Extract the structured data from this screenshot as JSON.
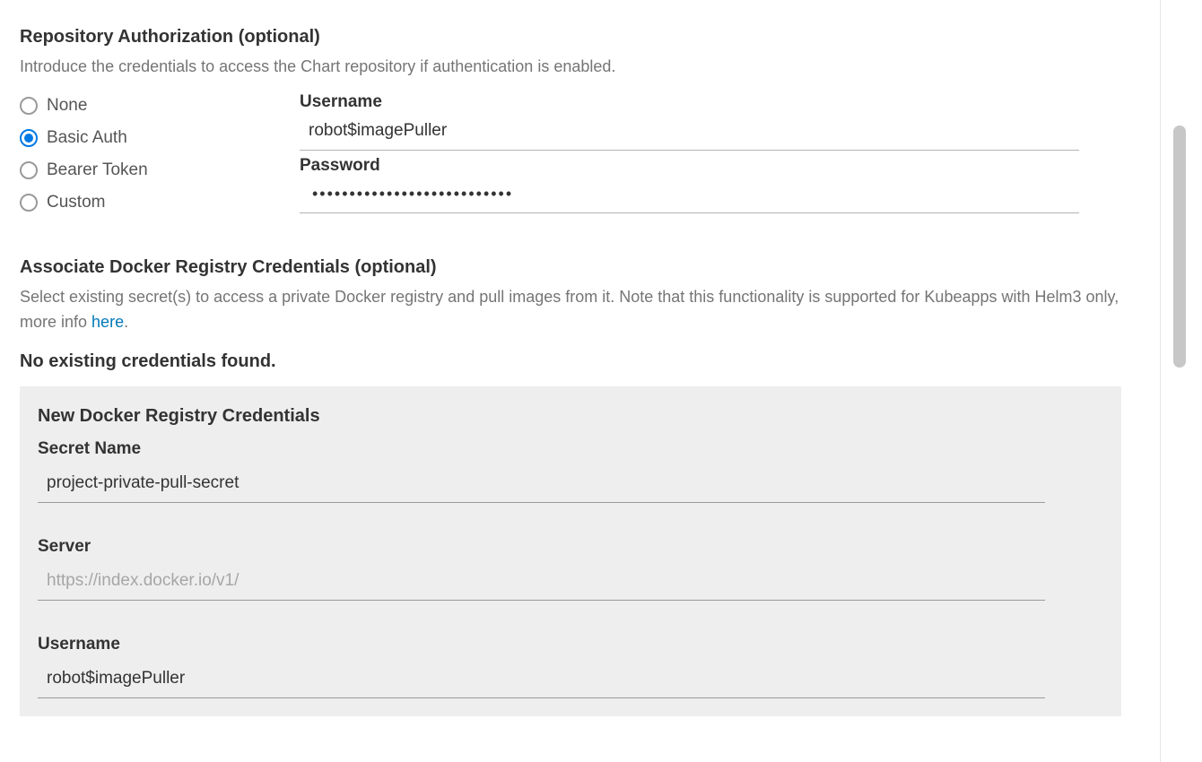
{
  "repoAuth": {
    "title": "Repository Authorization (optional)",
    "description": "Introduce the credentials to access the Chart repository if authentication is enabled.",
    "options": {
      "none": "None",
      "basic": "Basic Auth",
      "bearer": "Bearer Token",
      "custom": "Custom"
    },
    "selected": "basic",
    "usernameLabel": "Username",
    "usernameValue": "robot$imagePuller",
    "passwordLabel": "Password",
    "passwordMask": "•••••••••••••••••••••••••••"
  },
  "dockerSection": {
    "title": "Associate Docker Registry Credentials (optional)",
    "descriptionPrefix": "Select existing secret(s) to access a private Docker registry and pull images from it. Note that this functionality is supported for Kubeapps with Helm3 only, more info ",
    "hereLink": "here",
    "descriptionSuffix": ".",
    "noCredentials": "No existing credentials found.",
    "card": {
      "title": "New Docker Registry Credentials",
      "secretNameLabel": "Secret Name",
      "secretNameValue": "project-private-pull-secret",
      "serverLabel": "Server",
      "serverPlaceholder": "https://index.docker.io/v1/",
      "serverValue": "",
      "usernameLabel": "Username",
      "usernameValue": "robot$imagePuller"
    }
  }
}
